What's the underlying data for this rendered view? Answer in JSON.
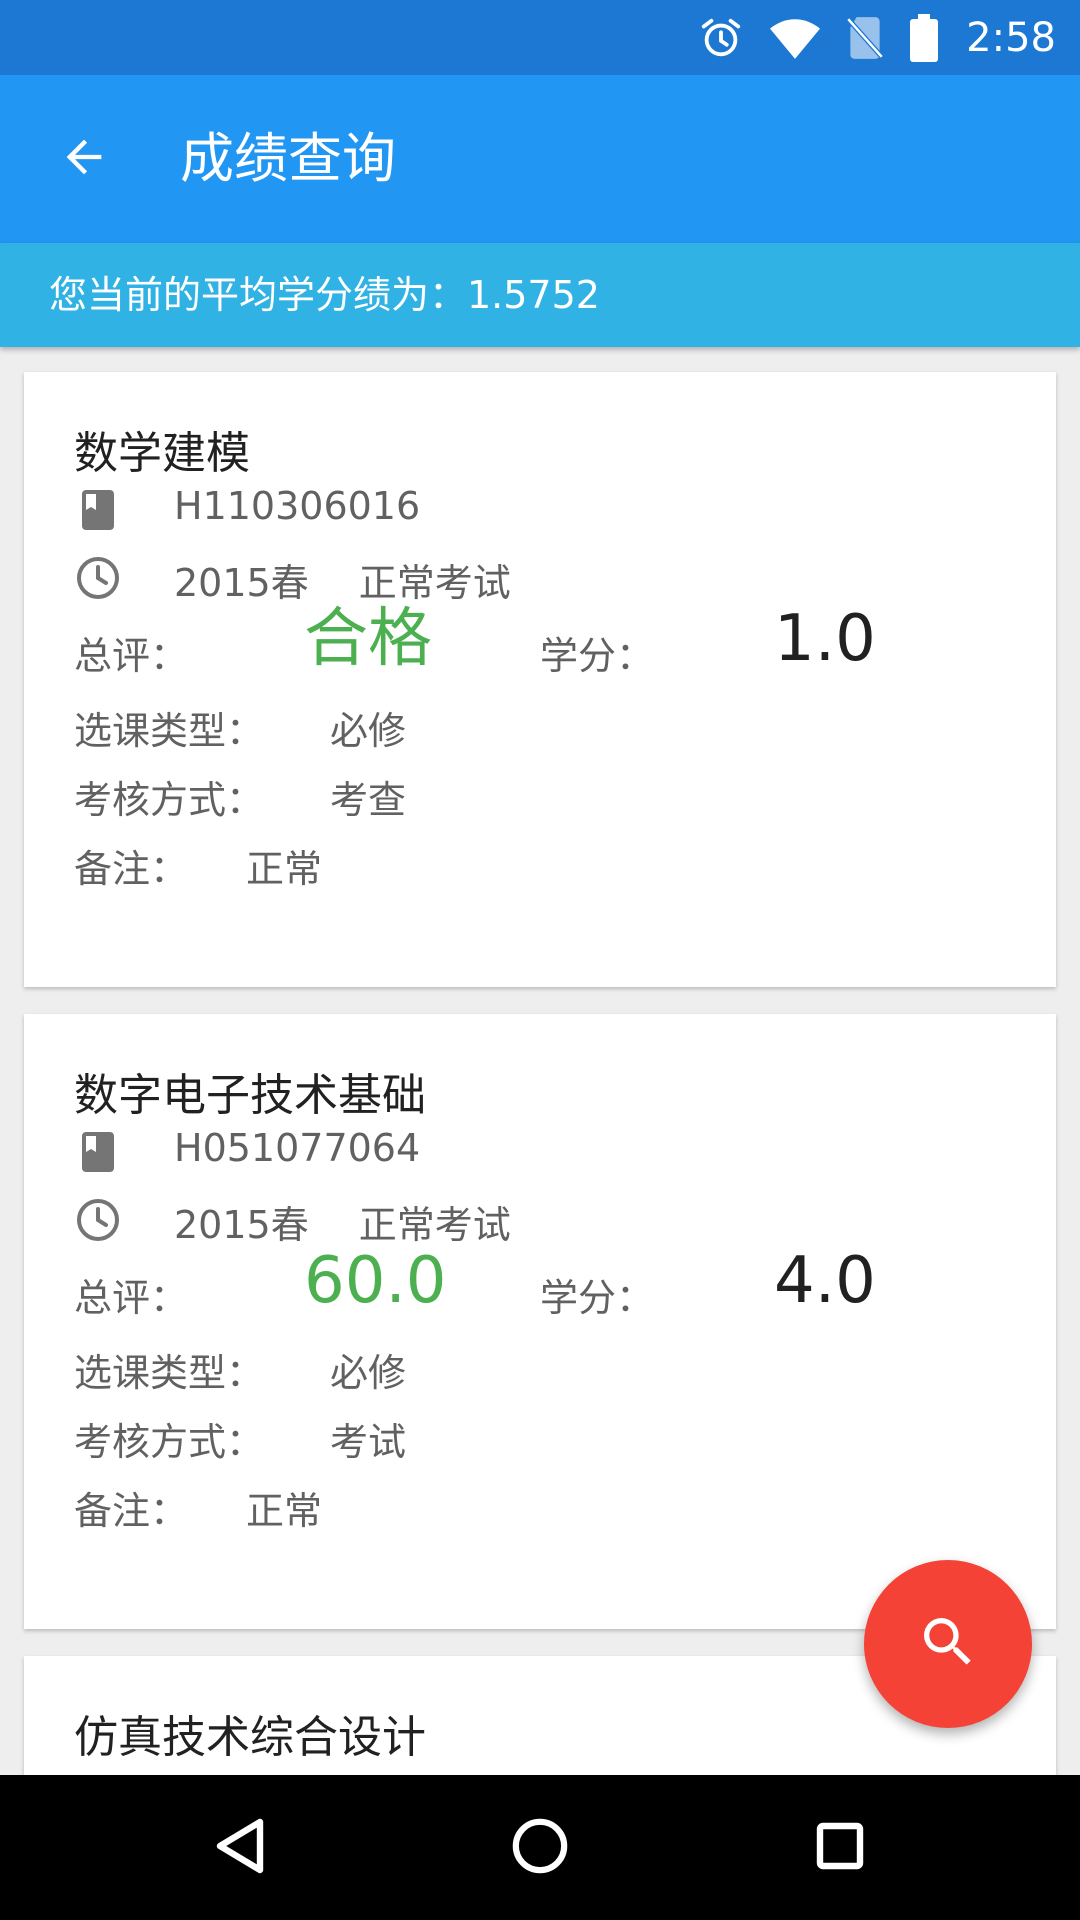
{
  "status_bar": {
    "time": "2:58",
    "icons": [
      "alarm-icon",
      "wifi-icon",
      "no-sim-icon",
      "battery-icon"
    ]
  },
  "app_bar": {
    "title": "成绩查询",
    "back_icon": "arrow-back-icon"
  },
  "gpa_banner": {
    "text": "您当前的平均学分绩为：1.5752"
  },
  "labels": {
    "overall": "总评：",
    "credit": "学分：",
    "course_type": "选课类型：",
    "assessment": "考核方式：",
    "remark": "备注："
  },
  "courses": [
    {
      "name": "数学建模",
      "code": "H110306016",
      "term": "2015春",
      "exam_type": "正常考试",
      "grade": "合格",
      "credit": "1.0",
      "course_type": "必修",
      "assessment": "考查",
      "remark": "正常"
    },
    {
      "name": "数字电子技术基础",
      "code": "H051077064",
      "term": "2015春",
      "exam_type": "正常考试",
      "grade": "60.0",
      "credit": "4.0",
      "course_type": "必修",
      "assessment": "考试",
      "remark": "正常"
    },
    {
      "name": "仿真技术综合设计"
    }
  ],
  "fab": {
    "icon": "search-icon"
  },
  "nav_bar": {
    "icons": [
      "back-triangle-icon",
      "home-circle-icon",
      "recents-square-icon"
    ]
  },
  "colors": {
    "status_bar": "#1c78d2",
    "app_bar": "#2196f3",
    "gpa_banner": "#31b2e4",
    "grade_green": "#4caf50",
    "fab_red": "#f44336"
  }
}
